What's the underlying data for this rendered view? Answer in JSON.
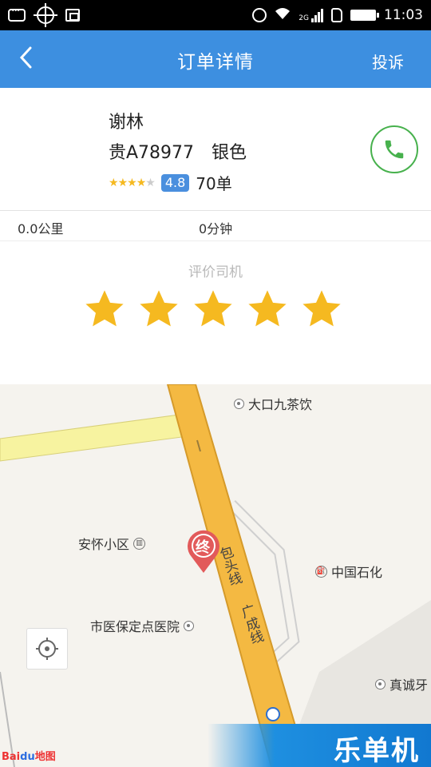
{
  "status_bar": {
    "time": "11:03",
    "network": "2G"
  },
  "header": {
    "back_icon": "chevron-left-icon",
    "title": "订单详情",
    "complain_label": "投诉"
  },
  "driver": {
    "name": "谢林",
    "plate": "贵A78977",
    "car_color": "银色",
    "stars_filled": 4,
    "stars_total": 5,
    "score": "4.8",
    "orders": "70单",
    "phone_icon": "phone-icon",
    "phone_color": "#47b14d"
  },
  "trip": {
    "distance": "0.0公里",
    "duration": "0分钟"
  },
  "rating": {
    "title": "评价司机",
    "stars": 5,
    "star_color": "#f5b920"
  },
  "map": {
    "pois": {
      "p1": "大口九茶饮",
      "p2": "安怀小区",
      "p3": "中国石化",
      "p4": "市医保定点医院",
      "p5": "真诚牙"
    },
    "road_a": "包头线",
    "road_b": "广成线",
    "end_marker": "终",
    "locate_icon": "locate-crosshair-icon",
    "logo_bai": "Bai",
    "logo_du": "du",
    "logo_map": "地图"
  },
  "watermark": "乐单机",
  "colors": {
    "header_bg": "#3d8fe0",
    "score_bg": "#4a8fde",
    "road": "#f4b942"
  }
}
